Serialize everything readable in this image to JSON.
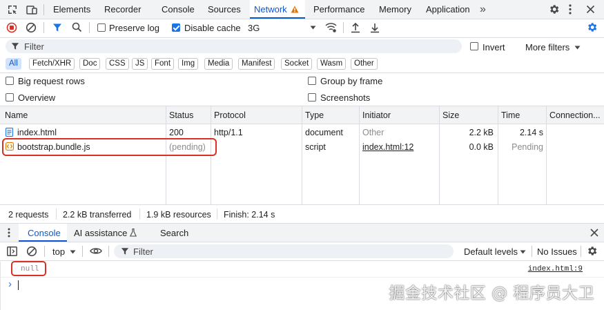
{
  "tabs": {
    "elements": "Elements",
    "recorder": "Recorder",
    "console": "Console",
    "sources": "Sources",
    "network": "Network",
    "performance": "Performance",
    "memory": "Memory",
    "application": "Application",
    "more": "»"
  },
  "toolbar": {
    "preserve_log": "Preserve log",
    "disable_cache": "Disable cache",
    "throttling": "3G"
  },
  "filter_bar": {
    "placeholder": "Filter",
    "invert": "Invert",
    "more_filters": "More filters"
  },
  "type_filters": [
    "All",
    "Fetch/XHR",
    "Doc",
    "CSS",
    "JS",
    "Font",
    "Img",
    "Media",
    "Manifest",
    "Socket",
    "Wasm",
    "Other"
  ],
  "options": {
    "big_request_rows": "Big request rows",
    "group_by_frame": "Group by frame",
    "overview": "Overview",
    "screenshots": "Screenshots"
  },
  "table": {
    "columns": [
      "Name",
      "Status",
      "Protocol",
      "Type",
      "Initiator",
      "Size",
      "Time",
      "Connection..."
    ],
    "rows": [
      {
        "name": "index.html",
        "status": "200",
        "protocol": "http/1.1",
        "type": "document",
        "initiator": "Other",
        "size": "2.2 kB",
        "time": "2.14 s"
      },
      {
        "name": "bootstrap.bundle.js",
        "status": "(pending)",
        "protocol": "",
        "type": "script",
        "initiator": "index.html:12",
        "size": "0.0 kB",
        "time": "Pending"
      }
    ]
  },
  "summary": {
    "requests": "2 requests",
    "transferred": "2.2 kB transferred",
    "resources": "1.9 kB resources",
    "finish": "Finish: 2.14 s"
  },
  "drawer": {
    "tabs": [
      "Console",
      "AI assistance",
      "Search"
    ]
  },
  "console_toolbar": {
    "context": "top",
    "filter_placeholder": "Filter",
    "levels": "Default levels",
    "issues": "No Issues"
  },
  "console_output": {
    "value": "null",
    "source": "index.html:9",
    "prompt": "›"
  },
  "watermark": "掘金技术社区 @ 程序员大卫",
  "colors": {
    "accent": "#0b57d0",
    "warning": "#e37400",
    "highlight_box": "#d93025",
    "record_red": "#d93025"
  }
}
